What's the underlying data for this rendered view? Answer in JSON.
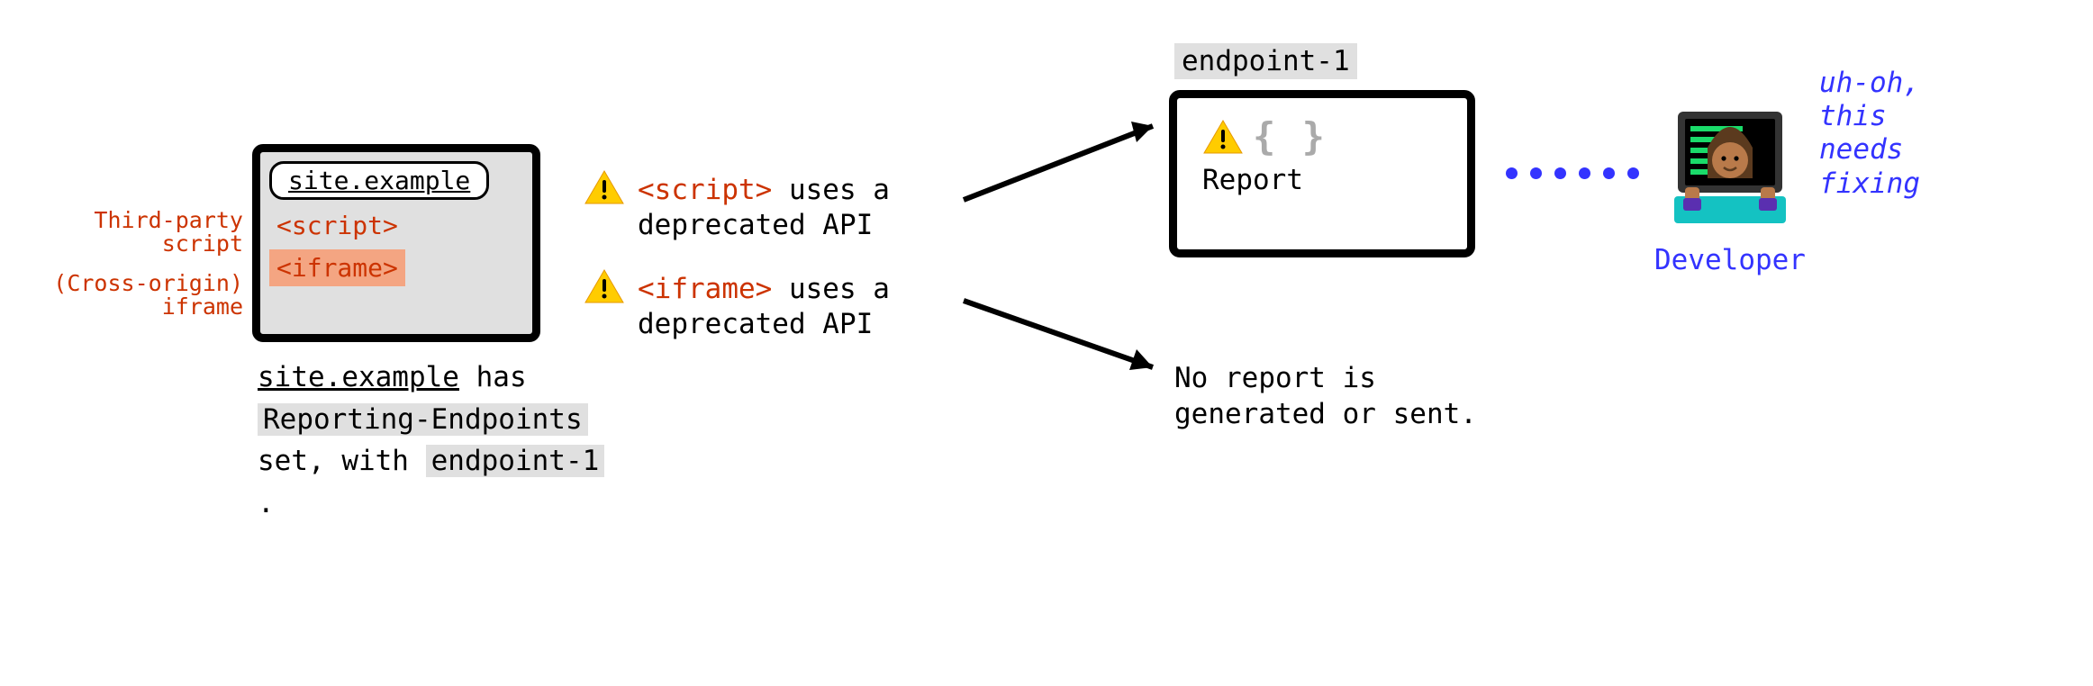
{
  "browser_window": {
    "url": "site.example",
    "script_tag": "<script>",
    "iframe_tag": "<iframe>"
  },
  "annotations": {
    "third_party_script_l1": "Third-party",
    "third_party_script_l2": "script",
    "cross_origin_iframe_l1": "(Cross-origin)",
    "cross_origin_iframe_l2": "iframe"
  },
  "caption": {
    "part1_site": "site.example",
    "part1_has": " has",
    "part2_header": "Reporting-Endpoints",
    "part3_setwith": "set, with ",
    "part3_endpoint": "endpoint-1",
    "part3_period": " ."
  },
  "events": {
    "script_event_tag": "<script>",
    "script_event_rest1": " uses a",
    "script_event_line2": "deprecated API",
    "iframe_event_tag": "<iframe>",
    "iframe_event_rest1": " uses a",
    "iframe_event_line2": "deprecated API"
  },
  "endpoint": {
    "label": "endpoint-1",
    "braces": "{ }",
    "report_label": "Report"
  },
  "no_report_l1": "No report is",
  "no_report_l2": "generated or sent.",
  "developer": {
    "label": "Developer",
    "thought_l1": "uh-oh,",
    "thought_l2": "this",
    "thought_l3": "needs",
    "thought_l4": "fixing"
  }
}
